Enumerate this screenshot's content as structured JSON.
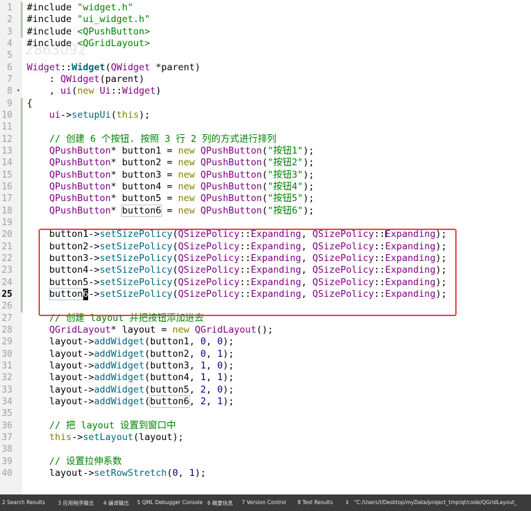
{
  "editor": {
    "current_line": 25,
    "watermark": "2863092",
    "lines": [
      {
        "n": "1",
        "tokens": [
          [
            "pp",
            "#include "
          ],
          [
            "str",
            "\"widget.h\""
          ]
        ]
      },
      {
        "n": "2",
        "tokens": [
          [
            "pp",
            "#include "
          ],
          [
            "str",
            "\"ui_widget.h\""
          ]
        ]
      },
      {
        "n": "3",
        "tokens": [
          [
            "pp",
            "#include "
          ],
          [
            "str",
            "<QPushButton>"
          ]
        ]
      },
      {
        "n": "4",
        "tokens": [
          [
            "pp",
            "#include "
          ],
          [
            "str",
            "<QGridLayout>"
          ]
        ]
      },
      {
        "n": "5",
        "tokens": []
      },
      {
        "n": "6",
        "tokens": [
          [
            "ty",
            "Widget"
          ],
          [
            "pl",
            "::"
          ],
          [
            "fnb",
            "Widget"
          ],
          [
            "pl",
            "("
          ],
          [
            "ty",
            "QWidget"
          ],
          [
            "pl",
            " *parent)"
          ]
        ]
      },
      {
        "n": "7",
        "tokens": [
          [
            "pl",
            "    : "
          ],
          [
            "ty",
            "QWidget"
          ],
          [
            "pl",
            "(parent)"
          ]
        ]
      },
      {
        "n": "8",
        "fold": true,
        "tokens": [
          [
            "pl",
            "    , "
          ],
          [
            "ty",
            "ui"
          ],
          [
            "pl",
            "("
          ],
          [
            "kw",
            "new"
          ],
          [
            "pl",
            " "
          ],
          [
            "ty",
            "Ui"
          ],
          [
            "pl",
            "::"
          ],
          [
            "ty",
            "Widget"
          ],
          [
            "pl",
            ")"
          ]
        ]
      },
      {
        "n": "9",
        "tokens": [
          [
            "pl",
            "{"
          ]
        ]
      },
      {
        "n": "10",
        "tokens": [
          [
            "pl",
            "    "
          ],
          [
            "ty",
            "ui"
          ],
          [
            "pl",
            "->"
          ],
          [
            "fn",
            "setupUi"
          ],
          [
            "pl",
            "("
          ],
          [
            "kw",
            "this"
          ],
          [
            "pl",
            ");"
          ]
        ]
      },
      {
        "n": "11",
        "tokens": []
      },
      {
        "n": "12",
        "tokens": [
          [
            "pl",
            "    "
          ],
          [
            "cm",
            "// 创建 6 个按钮. 按照 3 行 2 列的方式进行排列"
          ]
        ]
      },
      {
        "n": "13",
        "tokens": [
          [
            "pl",
            "    "
          ],
          [
            "ty",
            "QPushButton"
          ],
          [
            "pl",
            "* button1 = "
          ],
          [
            "kw",
            "new"
          ],
          [
            "pl",
            " "
          ],
          [
            "ty",
            "QPushButton"
          ],
          [
            "pl",
            "("
          ],
          [
            "str",
            "\"按钮1\""
          ],
          [
            "pl",
            ");"
          ]
        ]
      },
      {
        "n": "14",
        "tokens": [
          [
            "pl",
            "    "
          ],
          [
            "ty",
            "QPushButton"
          ],
          [
            "pl",
            "* button2 = "
          ],
          [
            "kw",
            "new"
          ],
          [
            "pl",
            " "
          ],
          [
            "ty",
            "QPushButton"
          ],
          [
            "pl",
            "("
          ],
          [
            "str",
            "\"按钮2\""
          ],
          [
            "pl",
            ");"
          ]
        ]
      },
      {
        "n": "15",
        "tokens": [
          [
            "pl",
            "    "
          ],
          [
            "ty",
            "QPushButton"
          ],
          [
            "pl",
            "* button3 = "
          ],
          [
            "kw",
            "new"
          ],
          [
            "pl",
            " "
          ],
          [
            "ty",
            "QPushButton"
          ],
          [
            "pl",
            "("
          ],
          [
            "str",
            "\"按钮3\""
          ],
          [
            "pl",
            ");"
          ]
        ]
      },
      {
        "n": "16",
        "tokens": [
          [
            "pl",
            "    "
          ],
          [
            "ty",
            "QPushButton"
          ],
          [
            "pl",
            "* button4 = "
          ],
          [
            "kw",
            "new"
          ],
          [
            "pl",
            " "
          ],
          [
            "ty",
            "QPushButton"
          ],
          [
            "pl",
            "("
          ],
          [
            "str",
            "\"按钮4\""
          ],
          [
            "pl",
            ");"
          ]
        ]
      },
      {
        "n": "17",
        "tokens": [
          [
            "pl",
            "    "
          ],
          [
            "ty",
            "QPushButton"
          ],
          [
            "pl",
            "* button5 = "
          ],
          [
            "kw",
            "new"
          ],
          [
            "pl",
            " "
          ],
          [
            "ty",
            "QPushButton"
          ],
          [
            "pl",
            "("
          ],
          [
            "str",
            "\"按钮5\""
          ],
          [
            "pl",
            ");"
          ]
        ]
      },
      {
        "n": "18",
        "tokens": [
          [
            "pl",
            "    "
          ],
          [
            "ty",
            "QPushButton"
          ],
          [
            "pl",
            "* "
          ],
          [
            "hl",
            "button6"
          ],
          [
            "pl",
            " = "
          ],
          [
            "kw",
            "new"
          ],
          [
            "pl",
            " "
          ],
          [
            "ty",
            "QPushButton"
          ],
          [
            "pl",
            "("
          ],
          [
            "str",
            "\"按钮6\""
          ],
          [
            "pl",
            ");"
          ]
        ]
      },
      {
        "n": "19",
        "tokens": []
      },
      {
        "n": "20",
        "tokens": [
          [
            "pl",
            "    button1->"
          ],
          [
            "fn",
            "setSizePolicy"
          ],
          [
            "pl",
            "("
          ],
          [
            "ty",
            "QSizePolicy"
          ],
          [
            "pl",
            "::"
          ],
          [
            "ty",
            "Expanding"
          ],
          [
            "pl",
            ", "
          ],
          [
            "ty",
            "QSizePolicy"
          ],
          [
            "pl",
            "::"
          ],
          [
            "ty",
            "Expanding"
          ],
          [
            "pl",
            ");"
          ]
        ]
      },
      {
        "n": "21",
        "tokens": [
          [
            "pl",
            "    button2->"
          ],
          [
            "fn",
            "setSizePolicy"
          ],
          [
            "pl",
            "("
          ],
          [
            "ty",
            "QSizePolicy"
          ],
          [
            "pl",
            "::"
          ],
          [
            "ty",
            "Expanding"
          ],
          [
            "pl",
            ", "
          ],
          [
            "ty",
            "QSizePolicy"
          ],
          [
            "pl",
            "::"
          ],
          [
            "ty",
            "Expanding"
          ],
          [
            "pl",
            ");"
          ]
        ]
      },
      {
        "n": "22",
        "tokens": [
          [
            "pl",
            "    button3->"
          ],
          [
            "fn",
            "setSizePolicy"
          ],
          [
            "pl",
            "("
          ],
          [
            "ty",
            "QSizePolicy"
          ],
          [
            "pl",
            "::"
          ],
          [
            "ty",
            "Expanding"
          ],
          [
            "pl",
            ", "
          ],
          [
            "ty",
            "QSizePolicy"
          ],
          [
            "pl",
            "::"
          ],
          [
            "ty",
            "Expanding"
          ],
          [
            "pl",
            ");"
          ]
        ]
      },
      {
        "n": "23",
        "tokens": [
          [
            "pl",
            "    button4->"
          ],
          [
            "fn",
            "setSizePolicy"
          ],
          [
            "pl",
            "("
          ],
          [
            "ty",
            "QSizePolicy"
          ],
          [
            "pl",
            "::"
          ],
          [
            "ty",
            "Expanding"
          ],
          [
            "pl",
            ", "
          ],
          [
            "ty",
            "QSizePolicy"
          ],
          [
            "pl",
            "::"
          ],
          [
            "ty",
            "Expanding"
          ],
          [
            "pl",
            ");"
          ]
        ]
      },
      {
        "n": "24",
        "tokens": [
          [
            "pl",
            "    button5->"
          ],
          [
            "fn",
            "setSizePolicy"
          ],
          [
            "pl",
            "("
          ],
          [
            "ty",
            "QSizePolicy"
          ],
          [
            "pl",
            "::"
          ],
          [
            "ty",
            "Expanding"
          ],
          [
            "pl",
            ", "
          ],
          [
            "ty",
            "QSizePolicy"
          ],
          [
            "pl",
            "::"
          ],
          [
            "ty",
            "Expanding"
          ],
          [
            "pl",
            ");"
          ]
        ]
      },
      {
        "n": "25",
        "tokens": [
          [
            "pl",
            "    "
          ],
          [
            "hl",
            "button"
          ],
          [
            "cur",
            "6"
          ],
          [
            "pl",
            "->"
          ],
          [
            "fn",
            "setSizePolicy"
          ],
          [
            "pl",
            "("
          ],
          [
            "ty",
            "QSizePolicy"
          ],
          [
            "pl",
            "::"
          ],
          [
            "ty",
            "Expanding"
          ],
          [
            "pl",
            ", "
          ],
          [
            "ty",
            "QSizePolicy"
          ],
          [
            "pl",
            "::"
          ],
          [
            "ty",
            "Expanding"
          ],
          [
            "pl",
            ");"
          ]
        ]
      },
      {
        "n": "26",
        "tokens": []
      },
      {
        "n": "27",
        "tokens": [
          [
            "pl",
            "    "
          ],
          [
            "cm",
            "// 创建 layout 并把按钮添加进去"
          ]
        ]
      },
      {
        "n": "28",
        "tokens": [
          [
            "pl",
            "    "
          ],
          [
            "ty",
            "QGridLayout"
          ],
          [
            "pl",
            "* layout = "
          ],
          [
            "kw",
            "new"
          ],
          [
            "pl",
            " "
          ],
          [
            "ty",
            "QGridLayout"
          ],
          [
            "pl",
            "();"
          ]
        ]
      },
      {
        "n": "29",
        "tokens": [
          [
            "pl",
            "    layout->"
          ],
          [
            "fn",
            "addWidget"
          ],
          [
            "pl",
            "(button1, "
          ],
          [
            "num",
            "0"
          ],
          [
            "pl",
            ", "
          ],
          [
            "num",
            "0"
          ],
          [
            "pl",
            ");"
          ]
        ]
      },
      {
        "n": "30",
        "tokens": [
          [
            "pl",
            "    layout->"
          ],
          [
            "fn",
            "addWidget"
          ],
          [
            "pl",
            "(button2, "
          ],
          [
            "num",
            "0"
          ],
          [
            "pl",
            ", "
          ],
          [
            "num",
            "1"
          ],
          [
            "pl",
            ");"
          ]
        ]
      },
      {
        "n": "31",
        "tokens": [
          [
            "pl",
            "    layout->"
          ],
          [
            "fn",
            "addWidget"
          ],
          [
            "pl",
            "(button3, "
          ],
          [
            "num",
            "1"
          ],
          [
            "pl",
            ", "
          ],
          [
            "num",
            "0"
          ],
          [
            "pl",
            ");"
          ]
        ]
      },
      {
        "n": "32",
        "tokens": [
          [
            "pl",
            "    layout->"
          ],
          [
            "fn",
            "addWidget"
          ],
          [
            "pl",
            "(button4, "
          ],
          [
            "num",
            "1"
          ],
          [
            "pl",
            ", "
          ],
          [
            "num",
            "1"
          ],
          [
            "pl",
            ");"
          ]
        ]
      },
      {
        "n": "33",
        "tokens": [
          [
            "pl",
            "    layout->"
          ],
          [
            "fn",
            "addWidget"
          ],
          [
            "pl",
            "(button5, "
          ],
          [
            "num",
            "2"
          ],
          [
            "pl",
            ", "
          ],
          [
            "num",
            "0"
          ],
          [
            "pl",
            ");"
          ]
        ]
      },
      {
        "n": "34",
        "tokens": [
          [
            "pl",
            "    layout->"
          ],
          [
            "fn",
            "addWidget"
          ],
          [
            "pl",
            "("
          ],
          [
            "hl",
            "button6"
          ],
          [
            "pl",
            ", "
          ],
          [
            "num",
            "2"
          ],
          [
            "pl",
            ", "
          ],
          [
            "num",
            "1"
          ],
          [
            "pl",
            ");"
          ]
        ]
      },
      {
        "n": "35",
        "tokens": []
      },
      {
        "n": "36",
        "tokens": [
          [
            "pl",
            "    "
          ],
          [
            "cm",
            "// 把 layout 设置到窗口中"
          ]
        ]
      },
      {
        "n": "37",
        "tokens": [
          [
            "pl",
            "    "
          ],
          [
            "kw",
            "this"
          ],
          [
            "pl",
            "->"
          ],
          [
            "fn",
            "setLayout"
          ],
          [
            "pl",
            "(layout);"
          ]
        ]
      },
      {
        "n": "38",
        "tokens": []
      },
      {
        "n": "39",
        "tokens": [
          [
            "pl",
            "    "
          ],
          [
            "cm",
            "// 设置拉伸系数"
          ]
        ]
      },
      {
        "n": "40",
        "tokens": [
          [
            "pl",
            "    layout->"
          ],
          [
            "fn",
            "setRowStretch"
          ],
          [
            "pl",
            "("
          ],
          [
            "num",
            "0"
          ],
          [
            "pl",
            ", "
          ],
          [
            "num",
            "1"
          ],
          [
            "pl",
            ");"
          ]
        ]
      }
    ]
  },
  "statusbar": {
    "items": [
      "2 Search Results",
      "3 应用程序输出",
      "4 编译输出",
      "5 QML Debugger Console",
      "6 概要信息",
      "7 Version Control",
      "8 Test Results",
      "⇕",
      "\"C:/Users/l/Desktop/myData/project_tmp/qt/code/QGridLayout_"
    ]
  },
  "colors": {
    "selection_box": "#e8413f",
    "keyword": "#808000",
    "type": "#800080",
    "function": "#00677c",
    "string": "#008000",
    "number": "#000080",
    "statusbar_bg": "#3b3b3b"
  },
  "icons": {
    "text_cursor": "I",
    "fold_marker": "▾"
  }
}
